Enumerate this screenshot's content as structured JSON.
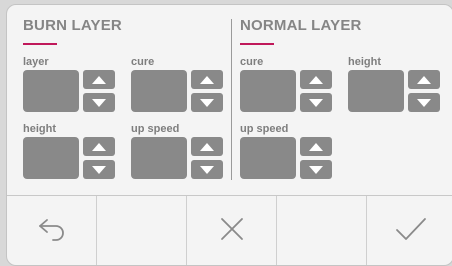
{
  "burn_layer": {
    "title": "BURN LAYER",
    "params": [
      {
        "label": "layer"
      },
      {
        "label": "cure"
      },
      {
        "label": "height"
      },
      {
        "label": "up speed"
      }
    ]
  },
  "normal_layer": {
    "title": "NORMAL LAYER",
    "params": [
      {
        "label": "cure"
      },
      {
        "label": "height"
      },
      {
        "label": "up speed"
      }
    ]
  },
  "colors": {
    "accent": "#c0185a",
    "control_gray": "#898989",
    "text_gray": "#858585",
    "panel_bg": "#f4f4f4"
  },
  "icons": {
    "back": "undo-arrow-icon",
    "cancel": "close-icon",
    "confirm": "checkmark-icon",
    "increment": "triangle-up-icon",
    "decrement": "triangle-down-icon"
  }
}
